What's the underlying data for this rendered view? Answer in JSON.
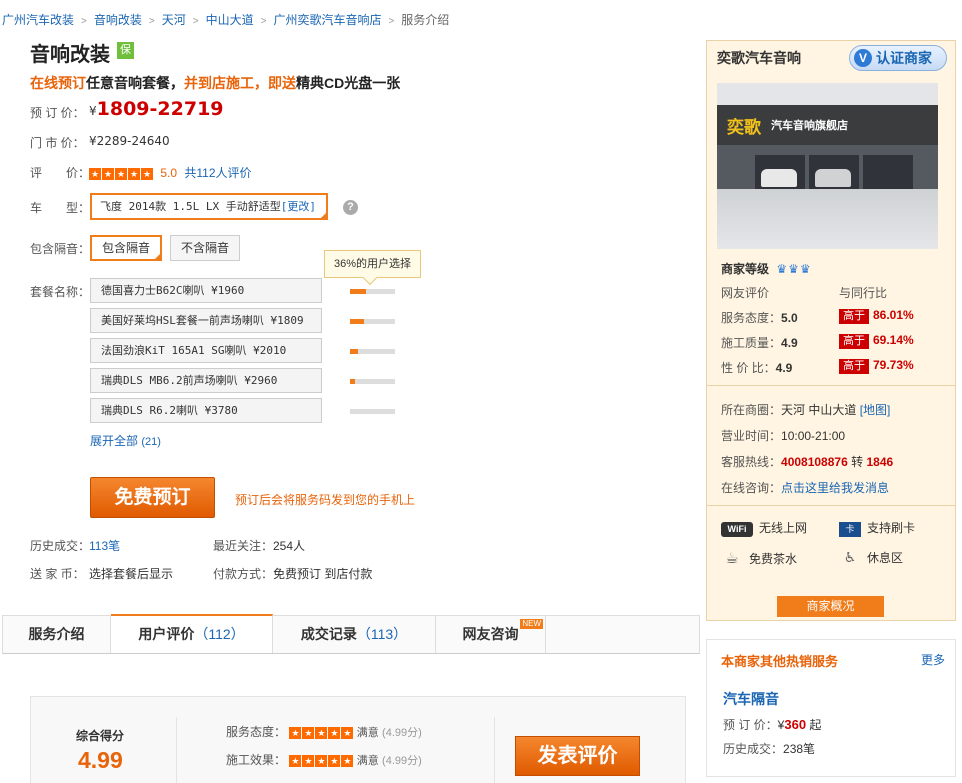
{
  "breadcrumb": {
    "items": [
      "广州汽车改装",
      "音响改装",
      "天河",
      "中山大道",
      "广州奕歌汽车音响店"
    ],
    "current": "服务介绍",
    "sep": ">"
  },
  "product": {
    "title": "音响改装",
    "badge": "保",
    "promo_part1": "在线预订",
    "promo_part2": "任意音响套餐，",
    "promo_part3": "并到店施工，即送",
    "promo_part4": "精典CD光盘一张",
    "booking_price_label": "预 订 价：",
    "booking_price_currency": "¥",
    "booking_price": "1809-22719",
    "store_price_label": "门 市 价：",
    "store_price": "¥2289-24640",
    "rating_label": "评　　价：",
    "rating_score": "5.0",
    "rating_count": "共112人评价",
    "rating_stars": 5,
    "car_label": "车　　型：",
    "car_value": "飞度 2014款 1.5L LX 手动舒适型",
    "car_change": "[更改]",
    "soundproof_label": "包含隔音：",
    "soundproof_options": [
      "包含隔音",
      "不含隔音"
    ],
    "soundproof_selected": 0,
    "tooltip": "36%的用户选择",
    "package_label": "套餐名称：",
    "packages": [
      {
        "name": "德国喜力士B62C喇叭 ¥1960",
        "popularity": 0.36
      },
      {
        "name": "美国好莱坞HSL套餐一前声场喇叭 ¥1809",
        "popularity": 0.3
      },
      {
        "name": "法国劲浪KiT 165A1 SG喇叭 ¥2010",
        "popularity": 0.18
      },
      {
        "name": "瑞典DLS MB6.2前声场喇叭 ¥2960",
        "popularity": 0.1
      },
      {
        "name": "瑞典DLS R6.2喇叭 ¥3780",
        "popularity": 0.0
      }
    ],
    "expand_all": "展开全部",
    "expand_count": "(21)",
    "book_button": "免费预订",
    "book_note": "预订后会将服务码发到您的手机上",
    "history_label": "历史成交：",
    "history_value": "113笔",
    "follow_label": "最近关注：",
    "follow_value": "254人",
    "coin_label": "送 家 币：",
    "coin_value": "选择套餐后显示",
    "pay_label": "付款方式：",
    "pay_value": "免费预订 到店付款"
  },
  "tabs": [
    {
      "label": "服务介绍",
      "count": ""
    },
    {
      "label": "用户评价",
      "count": "（112）"
    },
    {
      "label": "成交记录",
      "count": "（113）"
    },
    {
      "label": "网友咨询",
      "count": ""
    }
  ],
  "tab_new_badge": "NEW",
  "review": {
    "overall_label": "综合得分",
    "overall_score": "4.99",
    "items": [
      {
        "label": "服务态度：",
        "status": "满意",
        "score": "(4.99分)"
      },
      {
        "label": "施工效果：",
        "status": "满意",
        "score": "(4.99分)"
      }
    ],
    "post_button": "发表评价"
  },
  "shop": {
    "name": "奕歌汽车音响",
    "verified_label": "认证商家",
    "sign_big": "奕歌",
    "sign_small": "汽车音响旗舰店",
    "level_label": "商家等级",
    "col_left": "网友评价",
    "col_right": "与同行比",
    "ratings": [
      {
        "label": "服务态度：",
        "score": "5.0",
        "tag": "高于",
        "pct": "86.01%"
      },
      {
        "label": "施工质量：",
        "score": "4.9",
        "tag": "高于",
        "pct": "69.14%"
      },
      {
        "label": "性 价 比：",
        "score": "4.9",
        "tag": "高于",
        "pct": "79.73%"
      }
    ],
    "area_label": "所在商圈：",
    "area_value": "天河 中山大道",
    "map_link": "[地图]",
    "hours_label": "营业时间：",
    "hours_value": "10:00-21:00",
    "phone_label": "客服热线：",
    "phone_value": "4008108876",
    "phone_ext_label": "转",
    "phone_ext": "1846",
    "consult_label": "在线咨询：",
    "consult_link": "点击这里给我发消息",
    "amenities": [
      {
        "icon": "wifi-icon",
        "badge": "WiFi",
        "label": "无线上网"
      },
      {
        "icon": "card-icon",
        "badge": "卡",
        "label": "支持刷卡"
      },
      {
        "icon": "tea-icon",
        "badge": "☕",
        "label": "免费茶水"
      },
      {
        "icon": "rest-icon",
        "badge": "♿",
        "label": "休息区"
      }
    ],
    "overview_button": "商家概况"
  },
  "hot": {
    "title": "本商家其他热销服务",
    "more": "更多",
    "service_name": "汽车隔音",
    "price_label": "预 订 价：",
    "price_currency": "¥",
    "price": "360",
    "price_suffix": "起",
    "history_label": "历史成交：",
    "history_value": "238笔"
  },
  "colors": {
    "accent": "#f07c1a",
    "price": "#cc0000",
    "link": "#1a66b3"
  }
}
